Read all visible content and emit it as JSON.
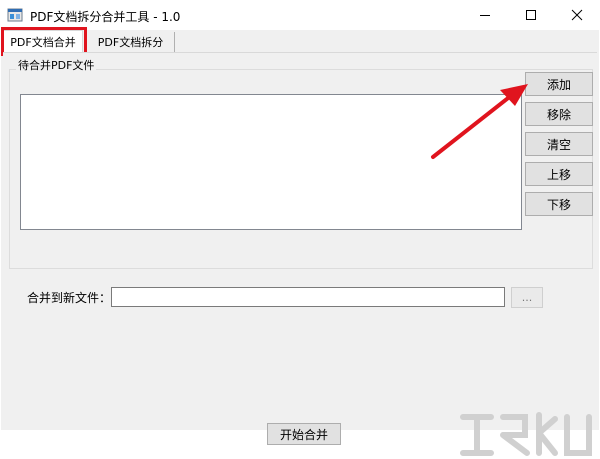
{
  "window": {
    "title": "PDF文档拆分合并工具 - 1.0",
    "minimize_icon": "minimize-icon",
    "maximize_icon": "maximize-icon",
    "close_icon": "close-icon"
  },
  "tabs": [
    {
      "label": "PDF文档合并",
      "active": true
    },
    {
      "label": "PDF文档拆分",
      "active": false
    }
  ],
  "merge": {
    "group_label": "待合并PDF文件",
    "files": [],
    "buttons": {
      "add": "添加",
      "remove": "移除",
      "clear": "清空",
      "up": "上移",
      "down": "下移"
    },
    "output_label": "合并到新文件：",
    "output_value": "",
    "browse_label": "...",
    "start_label": "开始合并"
  },
  "annotation": {
    "highlight_color": "#e0141e",
    "arrow_color": "#e0141e"
  },
  "colors": {
    "window_bg": "#f0f0f0",
    "button_bg": "#e1e1e1",
    "button_border": "#adadad"
  }
}
